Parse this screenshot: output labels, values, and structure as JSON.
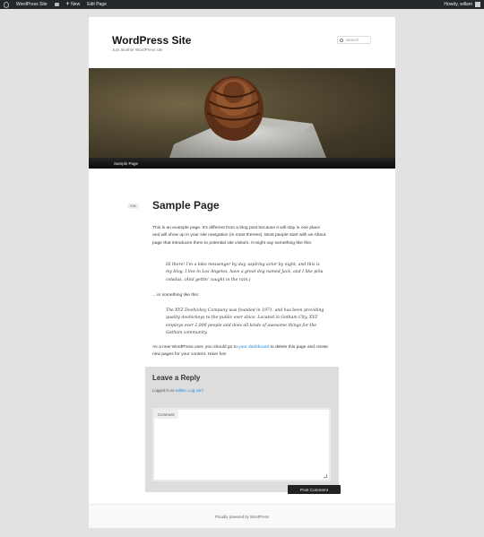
{
  "adminbar": {
    "site_name": "WordPress Site",
    "new_label": "New",
    "edit_label": "Edit Page",
    "howdy": "Howdy, willam"
  },
  "site": {
    "title": "WordPress Site",
    "description": "Just another WordPress site"
  },
  "search": {
    "placeholder": "Search"
  },
  "nav": {
    "items": [
      {
        "label": "Sample Page"
      }
    ]
  },
  "entry": {
    "edit_label": "Edit",
    "title": "Sample Page",
    "p1": "This is an example page. It's different from a blog post because it will stay in one place and will show up in your site navigation (in most themes). Most people start with an About page that introduces them to potential site visitors. It might say something like this:",
    "quote1": "Hi there! I'm a bike messenger by day, aspiring actor by night, and this is my blog. I live in Los Angeles, have a great dog named Jack, and I like piña coladas. (And gettin' caught in the rain.)",
    "p2": "…or something like this:",
    "quote2": "The XYZ Doohickey Company was founded in 1971, and has been providing quality doohickeys to the public ever since. Located in Gotham City, XYZ employs over 2,000 people and does all kinds of awesome things for the Gotham community.",
    "p3_before": "As a new WordPress user, you should go to ",
    "p3_link": "your dashboard",
    "p3_after": " to delete this page and create new pages for your content. Have fun!"
  },
  "comments": {
    "reply_title": "Leave a Reply",
    "logged_prefix": "Logged in as ",
    "user_link": "willam",
    "logout_link": "Log out?",
    "comment_label": "Comment",
    "submit_label": "Post Comment"
  },
  "footer": {
    "text": "Proudly powered by WordPress"
  },
  "colors": {
    "link": "#1b8be0",
    "adminbar": "#23282d",
    "nav": "#111111"
  }
}
